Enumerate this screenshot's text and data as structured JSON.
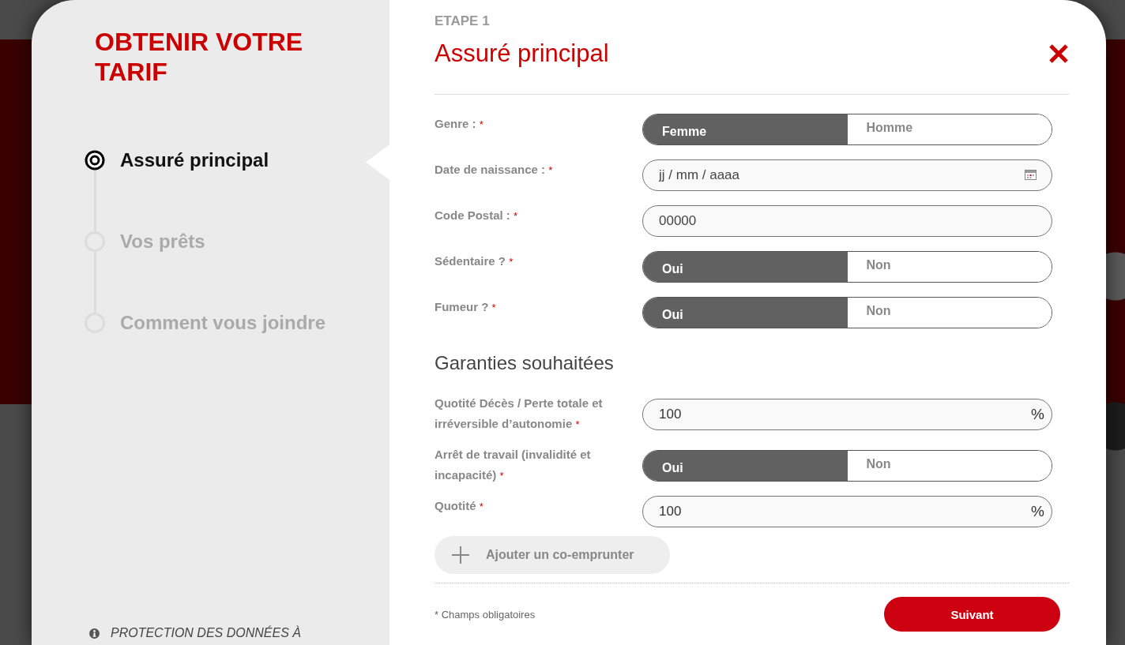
{
  "sidebar": {
    "title": "OBTENIR VOTRE TARIF",
    "steps": [
      {
        "label": "Assuré principal",
        "selected": true
      },
      {
        "label": "Vos prêts",
        "selected": false
      },
      {
        "label": "Comment vous joindre",
        "selected": false
      }
    ],
    "privacy_link": "PROTECTION DES DONNÉES À"
  },
  "header": {
    "step": "ETAPE 1",
    "title": "Assuré principal"
  },
  "fields": [
    {
      "kind": "toggle",
      "label": "Genre :",
      "asterisk": "*",
      "options": [
        {
          "label": "Femme",
          "selected": true
        },
        {
          "label": "Homme",
          "selected": false
        }
      ]
    },
    {
      "kind": "date",
      "label": "Date de naissance :",
      "asterisk": "*",
      "placeholder": "jj / mm / aaaa"
    },
    {
      "kind": "text",
      "label": "Code Postal :",
      "asterisk": "*",
      "placeholder": "00000"
    },
    {
      "kind": "toggle",
      "label": "Sédentaire ?",
      "asterisk": "*",
      "options": [
        {
          "label": "Oui",
          "selected": true
        },
        {
          "label": "Non",
          "selected": false
        }
      ]
    },
    {
      "kind": "toggle",
      "label": "Fumeur ?",
      "asterisk": "*",
      "options": [
        {
          "label": "Oui",
          "selected": true
        },
        {
          "label": "Non",
          "selected": false
        }
      ]
    }
  ],
  "guarantees": {
    "heading": "Garanties souhaitées",
    "fields": [
      {
        "kind": "percent",
        "label": "Quotité Décès / Perte totale et irréversible d’autonomie",
        "asterisk": "*",
        "value": "100",
        "unit": "%"
      },
      {
        "kind": "toggle",
        "label": "Arrêt de travail (invalidité et incapacité)",
        "asterisk": "*",
        "options": [
          {
            "label": "Oui",
            "selected": true
          },
          {
            "label": "Non",
            "selected": false
          }
        ]
      },
      {
        "kind": "percent",
        "label": "Quotité",
        "asterisk": "*",
        "value": "100",
        "unit": "%"
      }
    ]
  },
  "add_button": "Ajouter un co-emprunter",
  "footer": {
    "note": "* Champs obligatoires",
    "next_button": "Suivant"
  }
}
